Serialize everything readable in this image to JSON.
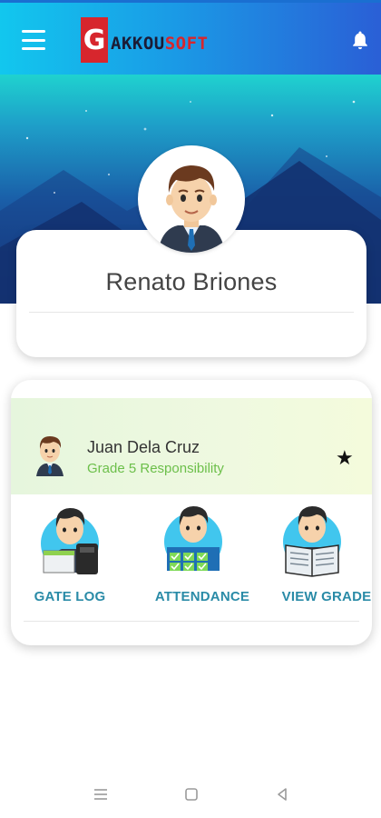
{
  "app": {
    "logo_letter": "G",
    "logo_text_dark": "AKKOU",
    "logo_text_red": "SOFT",
    "brand_colors": {
      "red": "#d7262d",
      "dark": "#1b1b35",
      "bar_start": "#12c7ee",
      "bar_end": "#2a5fd6"
    }
  },
  "header": {
    "menu_icon": "hamburger-menu-icon",
    "notification_icon": "bell-icon"
  },
  "profile": {
    "name": "Renato Briones",
    "avatar_icon": "male-teacher-avatar"
  },
  "student": {
    "name": "Juan Dela Cruz",
    "subtitle": "Grade 5 Responsibility",
    "favorite_symbol": "★",
    "avatar_icon": "student-avatar"
  },
  "features": [
    {
      "label": "GATE LOG",
      "icon": "gate-log-icon"
    },
    {
      "label": "ATTENDANCE",
      "icon": "attendance-icon"
    },
    {
      "label": "VIEW GRADE",
      "icon": "view-grade-icon"
    }
  ],
  "system_nav": {
    "recent": "recent-apps-icon",
    "home": "home-icon",
    "back": "back-icon"
  },
  "colors": {
    "accent_label": "#2a8ba7",
    "grade_text": "#6cbf4a",
    "student_bar": "#e6f6dd"
  }
}
